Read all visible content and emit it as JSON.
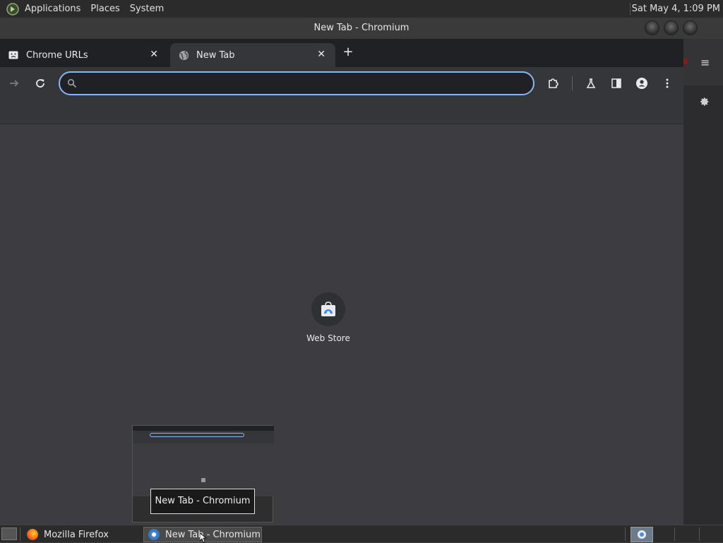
{
  "top_panel": {
    "menus": [
      "Applications",
      "Places",
      "System"
    ],
    "clock": "Sat May  4,  1:09 PM"
  },
  "window": {
    "title": "New Tab - Chromium"
  },
  "tabs": [
    {
      "label": "Chrome URLs",
      "icon": "sad-face-icon",
      "active": false
    },
    {
      "label": "New Tab",
      "icon": "globe-icon",
      "active": true
    }
  ],
  "toolbar": {
    "omnibox_value": "",
    "omnibox_placeholder": ""
  },
  "content": {
    "shortcut_label": "Web Store"
  },
  "preview": {
    "caption": "New Tab - Chromium"
  },
  "taskbar": {
    "tasks": [
      "Mozilla Firefox",
      "New Tab - Chromium"
    ]
  },
  "colors": {
    "focus_ring": "#8ab4f8",
    "content_bg": "#3c3c41",
    "tabstrip_bg": "#202124"
  }
}
